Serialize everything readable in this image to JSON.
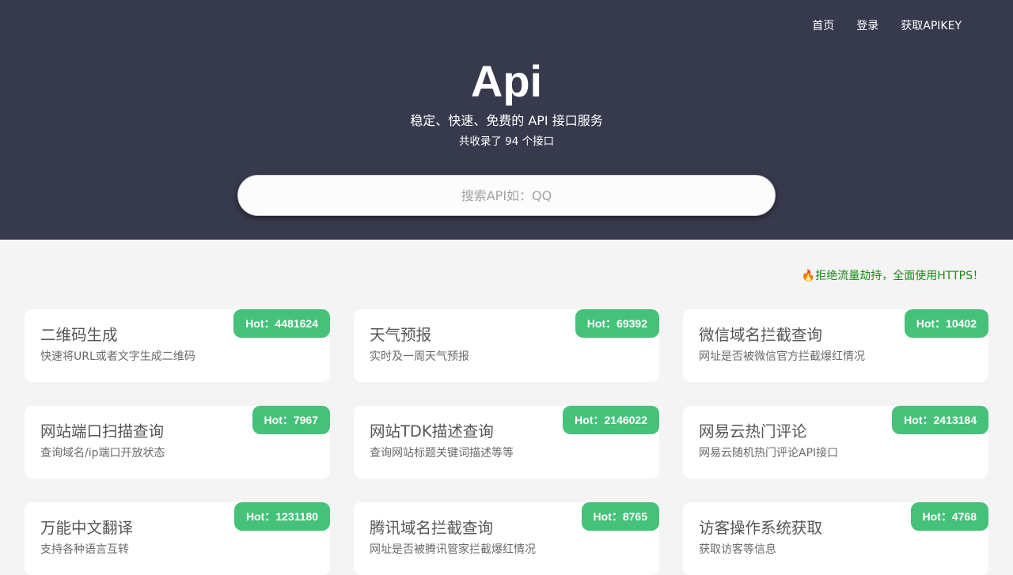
{
  "nav": [
    "首页",
    "登录",
    "获取APIKEY"
  ],
  "hero": {
    "title": "Api",
    "tagline": "稳定、快速、免费的 API 接口服务",
    "count_text": "共收录了 94 个接口"
  },
  "search": {
    "placeholder": "搜索API如：QQ"
  },
  "notice": {
    "icon": "fire-icon",
    "text": "拒绝流量劫持，全面使用HTTPS！"
  },
  "cards": [
    {
      "title": "二维码生成",
      "desc": "快速将URL或者文字生成二维码",
      "hot": "Hot：4481624"
    },
    {
      "title": "天气预报",
      "desc": "实时及一周天气预报",
      "hot": "Hot：69392"
    },
    {
      "title": "微信域名拦截查询",
      "desc": "网址是否被微信官方拦截爆红情况",
      "hot": "Hot：10402"
    },
    {
      "title": "网站端口扫描查询",
      "desc": "查询域名/ip端口开放状态",
      "hot": "Hot：7967"
    },
    {
      "title": "网站TDK描述查询",
      "desc": "查询网站标题关键词描述等等",
      "hot": "Hot：2146022"
    },
    {
      "title": "网易云热门评论",
      "desc": "网易云随机热门评论API接口",
      "hot": "Hot：2413184"
    },
    {
      "title": "万能中文翻译",
      "desc": "支持各种语言互转",
      "hot": "Hot：1231180"
    },
    {
      "title": "腾讯域名拦截查询",
      "desc": "网址是否被腾讯管家拦截爆红情况",
      "hot": "Hot：8765"
    },
    {
      "title": "访客操作系统获取",
      "desc": "获取访客等信息",
      "hot": "Hot：4768"
    }
  ],
  "colors": {
    "hero_bg": "#373a4c",
    "badge": "#46c17a",
    "notice": "#138d13",
    "page_bg": "#f4f4f4"
  }
}
